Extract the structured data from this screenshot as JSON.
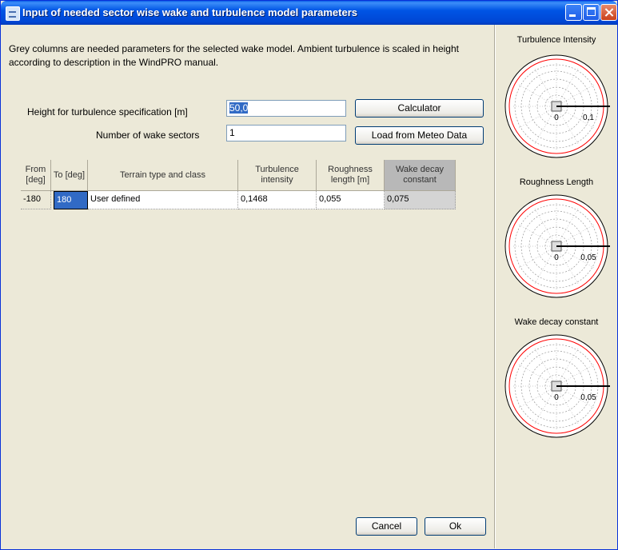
{
  "window": {
    "title": "Input of needed sector wise wake and turbulence model parameters"
  },
  "description": "Grey columns are needed parameters for the selected wake model. Ambient turbulence is scaled in height according to description in the WindPRO manual.",
  "form": {
    "height_label": "Height for turbulence specification [m]",
    "height_value": "50,0",
    "sectors_label": "Number of wake sectors",
    "sectors_value": "1",
    "calculator_button": "Calculator",
    "load_meteo_button": "Load from Meteo Data"
  },
  "table": {
    "headers": {
      "from": "From [deg]",
      "to": "To [deg]",
      "terrain": "Terrain type and class",
      "turbulence": "Turbulence intensity",
      "roughness": "Roughness length [m]",
      "wake_decay": "Wake decay constant"
    },
    "rows": [
      {
        "from": "-180",
        "to": "180",
        "terrain": "User defined",
        "turbulence": "0,1468",
        "roughness": "0,055",
        "wake_decay": "0,075"
      }
    ]
  },
  "footer": {
    "cancel": "Cancel",
    "ok": "Ok"
  },
  "side_plots": [
    {
      "title": "Turbulence Intensity",
      "center_label": "0",
      "scale_label": "0,1"
    },
    {
      "title": "Roughness Length",
      "center_label": "0",
      "scale_label": "0,05"
    },
    {
      "title": "Wake decay constant",
      "center_label": "0",
      "scale_label": "0,05"
    }
  ],
  "colors": {
    "title_bar": "#0055e5",
    "selection": "#316ac5",
    "grey_column": "#b8b8b8",
    "polar_ring": "#ff0000"
  }
}
